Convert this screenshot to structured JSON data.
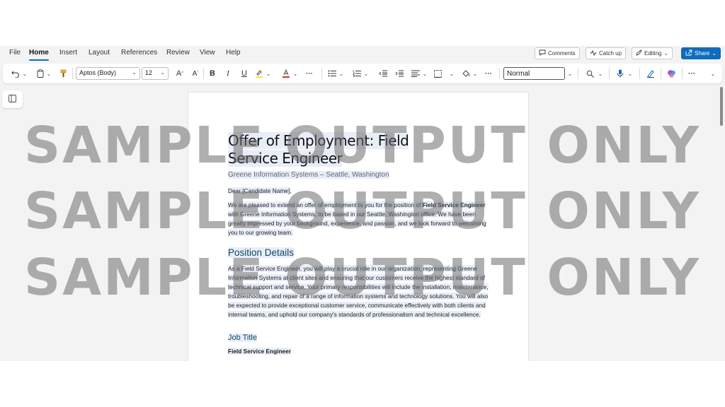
{
  "menu": {
    "items": [
      "File",
      "Home",
      "Insert",
      "Layout",
      "References",
      "Review",
      "View",
      "Help"
    ],
    "active": "Home"
  },
  "top_actions": {
    "comments": "Comments",
    "catch_up": "Catch up",
    "editing": "Editing",
    "share": "Share"
  },
  "ribbon": {
    "font_name": "Aptos (Body)",
    "font_size": "12",
    "style": "Normal",
    "icons": [
      "undo-icon",
      "clipboard-icon",
      "format-painter-icon",
      "grow-font-icon",
      "shrink-font-icon",
      "bold-icon",
      "italic-icon",
      "underline-icon",
      "highlight-icon",
      "font-color-icon",
      "more-icon",
      "bullets-icon",
      "numbering-icon",
      "decrease-indent-icon",
      "increase-indent-icon",
      "align-icon",
      "borders-icon",
      "shading-icon",
      "find-icon",
      "dictate-icon",
      "editor-icon",
      "copilot-icon"
    ]
  },
  "document": {
    "title": "Offer of Employment: Field Service Engineer",
    "subtitle": "Greene Information Systems – Seattle, Washington",
    "salutation": "Dear [Candidate Name],",
    "intro": {
      "before": "We are pleased to extend an offer of employment to you for the position of ",
      "bold": "Field Service Engineer",
      "after": " with Greene Information Systems, to be based in our Seattle, Washington office. We have been greatly impressed by your background, experience, and passion, and we look forward to welcoming you to our growing team."
    },
    "section_heading": "Position Details",
    "section_body": "As a Field Service Engineer, you will play a crucial role in our organization, representing Greene Information Systems at client sites and ensuring that our customers receive the highest standard of technical support and service. Your primary responsibilities will include the installation, maintenance, troubleshooting, and repair of a range of information systems and technology solutions. You will also be expected to provide exceptional customer service, communicate effectively with both clients and internal teams, and uphold our company's standards of professionalism and technical excellence.",
    "subheading": "Job Title",
    "job_title_value": "Field Service Engineer"
  },
  "watermark": {
    "line1": "SAMPLE OUTPUT ONLY",
    "line2": "SAMPLE OUTPUT ONLY",
    "line3": "SAMPLE OUTPUT ONLY"
  },
  "colors": {
    "accent": "#0f6cbd",
    "heading": "#0f4761",
    "selection_highlight": "#e8eef8"
  }
}
